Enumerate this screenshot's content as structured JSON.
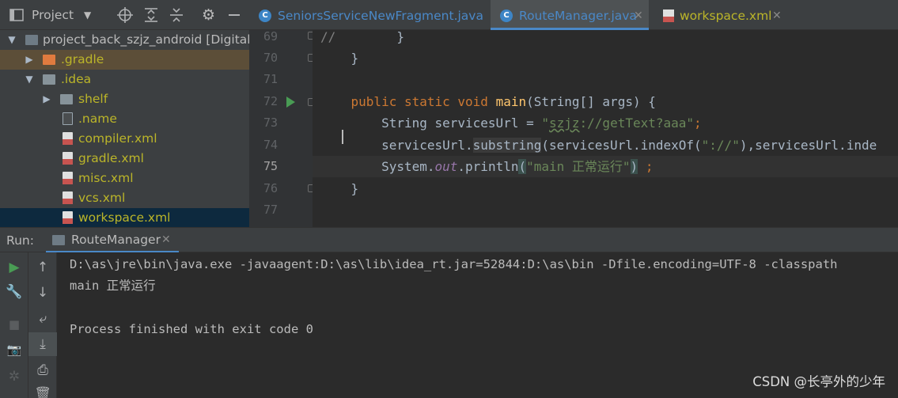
{
  "project_panel": {
    "title": "Project",
    "tree": [
      {
        "label": "project_back_szjz_android [DigitalM",
        "type": "module",
        "expanded": true
      },
      {
        "label": ".gradle",
        "type": "folder",
        "expanded": false,
        "color": "#bbb529"
      },
      {
        "label": ".idea",
        "type": "folder",
        "expanded": true,
        "color": "#bbb529"
      },
      {
        "label": "shelf",
        "type": "folder",
        "expanded": false,
        "color": "#bbb529"
      },
      {
        "label": ".name",
        "type": "file",
        "color": "#bbb529"
      },
      {
        "label": "compiler.xml",
        "type": "xml",
        "color": "#bbb529"
      },
      {
        "label": "gradle.xml",
        "type": "xml",
        "color": "#bbb529"
      },
      {
        "label": "misc.xml",
        "type": "xml",
        "color": "#bbb529"
      },
      {
        "label": "vcs.xml",
        "type": "xml",
        "color": "#bbb529"
      },
      {
        "label": "workspace.xml",
        "type": "xml",
        "color": "#bbb529",
        "selected": true
      }
    ]
  },
  "editor": {
    "tabs": [
      {
        "label": "SeniorsServiceNewFragment.java",
        "active": false
      },
      {
        "label": "RouteManager.java",
        "active": true
      },
      {
        "label": "workspace.xml",
        "active": false
      }
    ],
    "line_numbers": [
      "69",
      "70",
      "71",
      "72",
      "73",
      "74",
      "75",
      "76",
      "77"
    ],
    "current_line": "75",
    "code": {
      "l69_comment": "//",
      "l69_brace": "        }",
      "l70": "    }",
      "l72_kw": "    public static void ",
      "l72_fn": "main",
      "l72_rest": "(String[] args) {",
      "l73_a": "        String servicesUrl = ",
      "l73_str1": "\"",
      "l73_str2": "szjz",
      "l73_str3": "://getText?aaa\"",
      "l73_end": ";",
      "l74_a": "        servicesUrl.",
      "l74_fn": "substring",
      "l74_b": "(servicesUrl.indexOf(",
      "l74_str": "\"://\"",
      "l74_c": "),servicesUrl.inde",
      "l75_a": "        System.",
      "l75_out": "out",
      "l75_b": ".println",
      "l75_paren": "(",
      "l75_str": "\"main 正常运行\"",
      "l75_paren2": ")",
      "l75_end": " ;",
      "l76": "    }"
    }
  },
  "run_panel": {
    "label": "Run:",
    "tab_label": "RouteManager",
    "console": [
      "D:\\as\\jre\\bin\\java.exe -javaagent:D:\\as\\lib\\idea_rt.jar=52844:D:\\as\\bin -Dfile.encoding=UTF-8 -classpath",
      "main 正常运行",
      "",
      "Process finished with exit code 0"
    ]
  },
  "watermark": "CSDN @长亭外的少年",
  "colors": {
    "accent": "#4a88c7",
    "keyword": "#cc7832",
    "string": "#6a8759",
    "function": "#ffc66d",
    "run_green": "#499c54"
  }
}
